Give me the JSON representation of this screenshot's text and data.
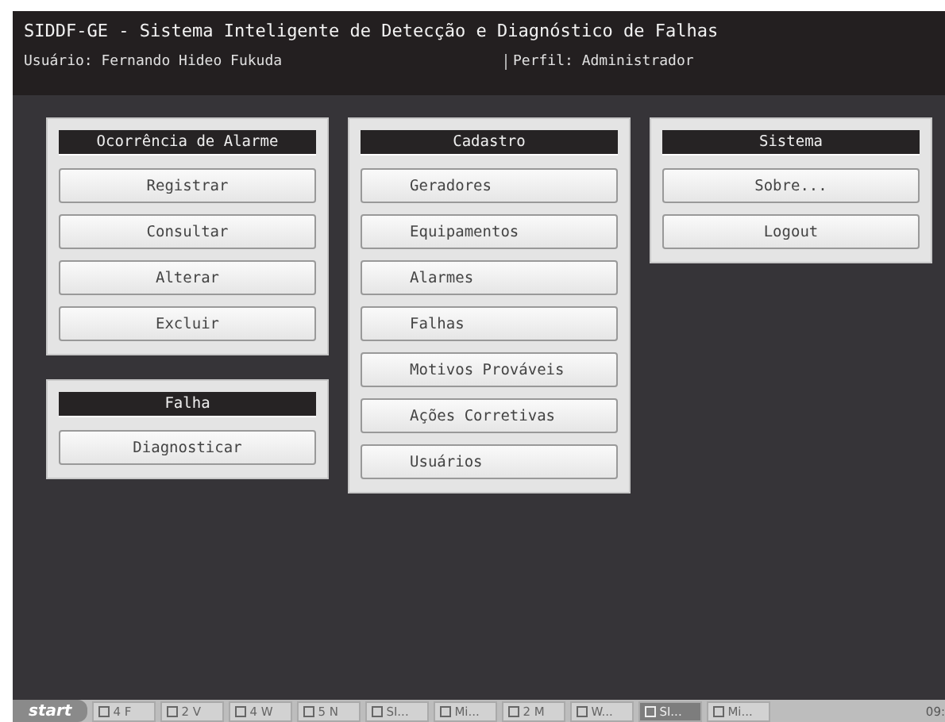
{
  "window": {
    "title": "SIDDF-GE - Sistema Inteligente de Detecção e Diagnóstico de Falhas",
    "user": "Usuário: Fernando Hideo Fukuda",
    "profile": "Perfil: Administrador"
  },
  "columns": [
    {
      "panels": [
        {
          "title": "Ocorrência de Alarme",
          "kind": "centered",
          "buttons": [
            "Registrar",
            "Consultar",
            "Alterar",
            "Excluir"
          ]
        },
        {
          "title": "Falha",
          "kind": "centered",
          "buttons": [
            "Diagnosticar"
          ]
        }
      ]
    },
    {
      "panels": [
        {
          "title": "Cadastro",
          "kind": "indented",
          "buttons": [
            "Geradores",
            "Equipamentos",
            "Alarmes",
            "Falhas",
            "Motivos Prováveis",
            "Ações Corretivas",
            "Usuários"
          ]
        }
      ]
    },
    {
      "panels": [
        {
          "title": "Sistema",
          "kind": "centered",
          "buttons": [
            "Sobre...",
            "Logout"
          ]
        }
      ]
    }
  ],
  "taskbar": {
    "start": "start",
    "tasks": [
      {
        "label": "4 F",
        "selected": false
      },
      {
        "label": "2 V",
        "selected": false
      },
      {
        "label": "4 W",
        "selected": false
      },
      {
        "label": "5 N",
        "selected": false
      },
      {
        "label": "SI...",
        "selected": false
      },
      {
        "label": "Mi...",
        "selected": false
      },
      {
        "label": "2 M",
        "selected": false
      },
      {
        "label": "W...",
        "selected": false
      },
      {
        "label": "SI...",
        "selected": true
      },
      {
        "label": "Mi...",
        "selected": false
      }
    ],
    "clock": "09:"
  }
}
